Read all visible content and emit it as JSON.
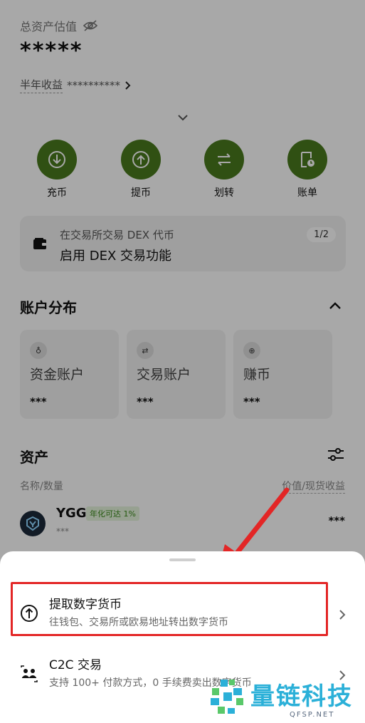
{
  "header": {
    "total_label": "总资产估值",
    "total_value": "*****",
    "half_year_label": "半年收益",
    "half_year_value": "**********"
  },
  "actions": [
    {
      "label": "充币",
      "icon": "deposit-icon"
    },
    {
      "label": "提币",
      "icon": "withdraw-icon"
    },
    {
      "label": "划转",
      "icon": "transfer-icon"
    },
    {
      "label": "账单",
      "icon": "bill-icon"
    }
  ],
  "dex_banner": {
    "line1": "在交易所交易 DEX 代币",
    "line2": "启用 DEX 交易功能",
    "pager": "1/2"
  },
  "account_distribution": {
    "title": "账户分布",
    "cards": [
      {
        "name": "资金账户",
        "value": "***",
        "icon": "fund-icon"
      },
      {
        "name": "交易账户",
        "value": "***",
        "icon": "trade-icon"
      },
      {
        "name": "赚币",
        "value": "***",
        "icon": "earn-icon"
      }
    ]
  },
  "assets": {
    "title": "资产",
    "col_left": "名称/数量",
    "col_right": "价值/现货收益",
    "rows": [
      {
        "name": "YGG",
        "tag": "年化可达 1%",
        "amount": "***",
        "value": "***"
      }
    ]
  },
  "sheet": {
    "items": [
      {
        "title": "提取数字货币",
        "desc": "往钱包、交易所或欧易地址转出数字货币",
        "icon": "withdraw-icon"
      },
      {
        "title": "C2C 交易",
        "desc": "支持 100+ 付款方式，0 手续费卖出数字货币",
        "icon": "c2c-icon"
      }
    ]
  },
  "watermark": {
    "text": "量链科技",
    "sub": "QFSP.NET"
  },
  "colors": {
    "accent_green": "#4a7a1e",
    "highlight_red": "#e32626",
    "tag_green": "#3a8a1a"
  }
}
